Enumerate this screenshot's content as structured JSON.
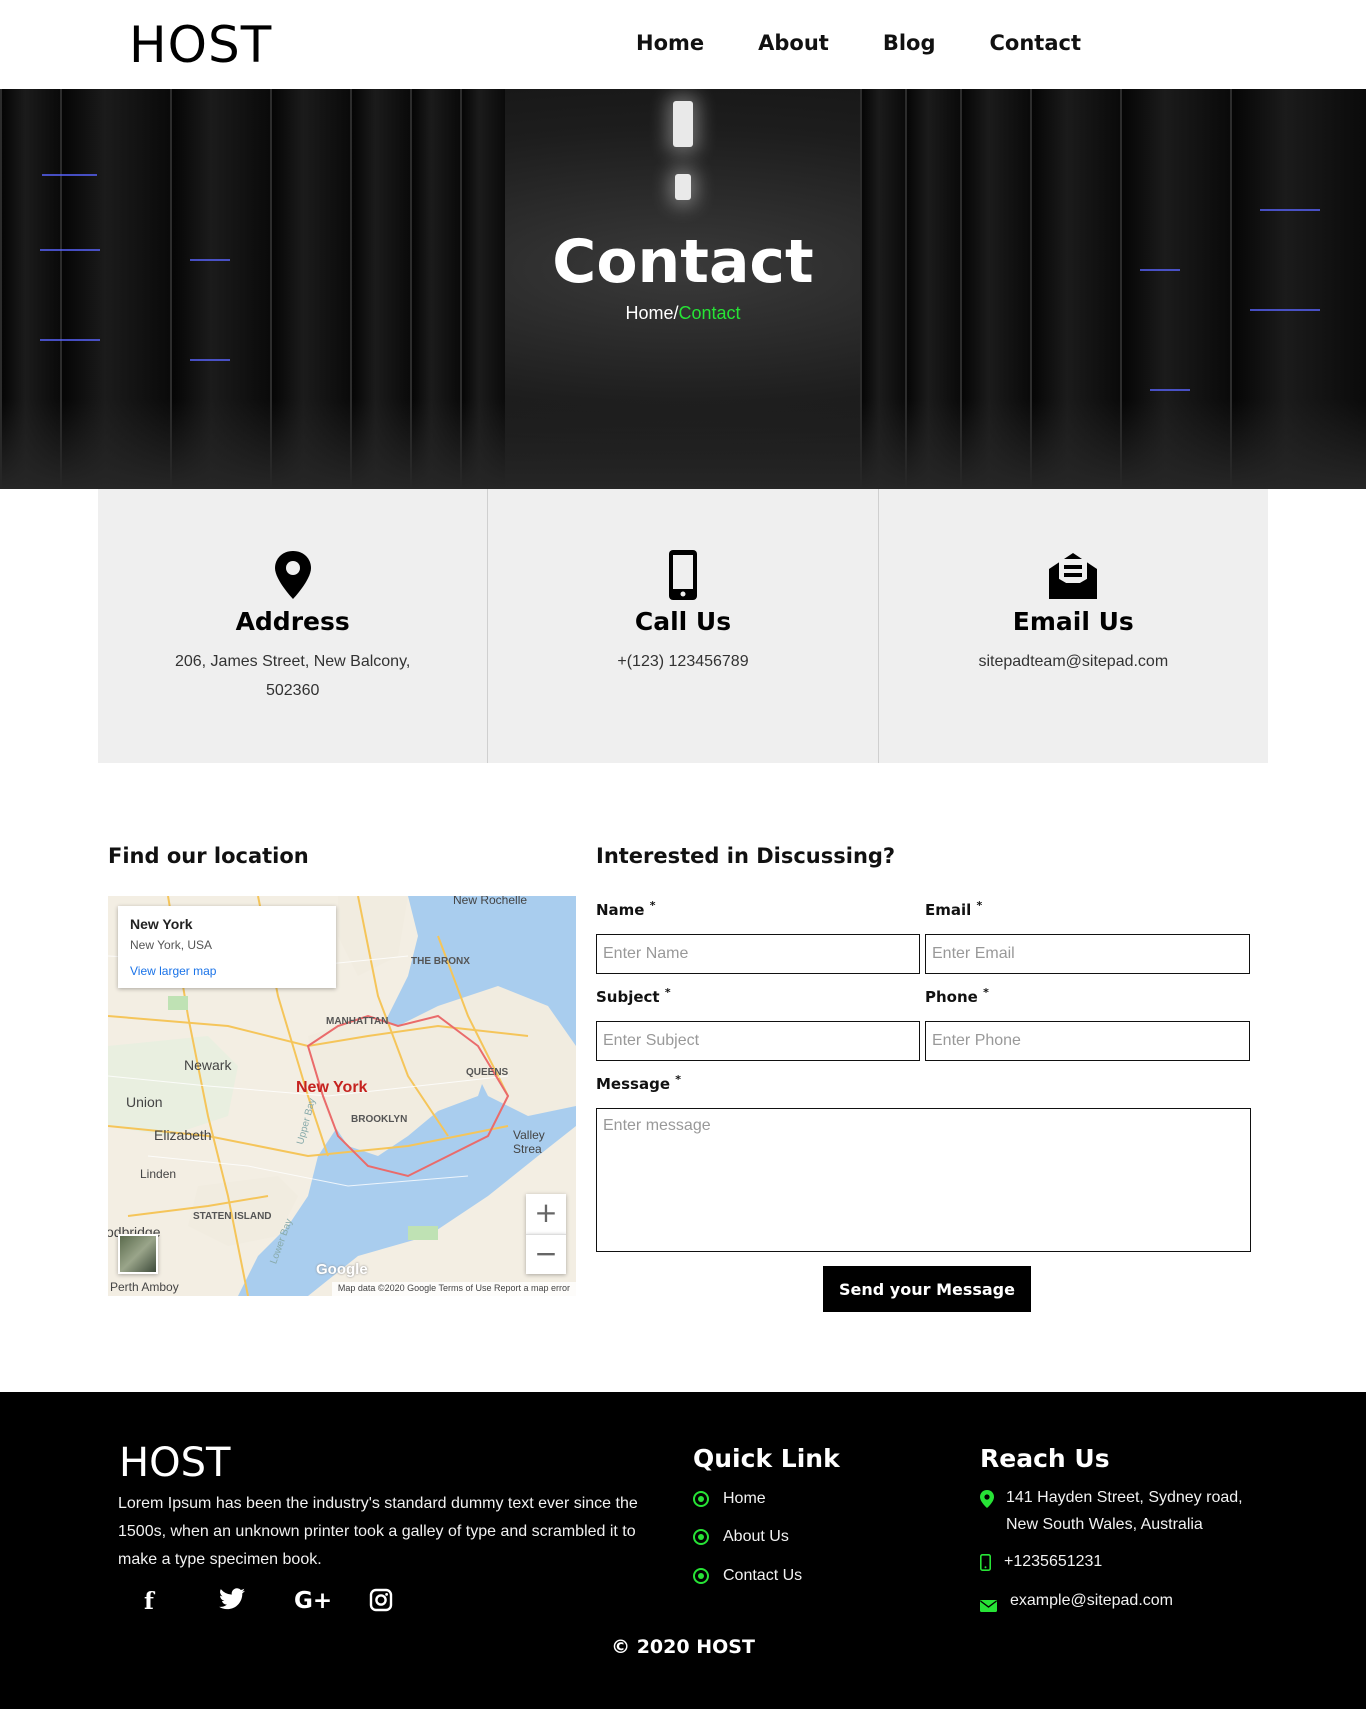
{
  "header": {
    "logo": "HOST",
    "nav": [
      {
        "label": "Home"
      },
      {
        "label": "About"
      },
      {
        "label": "Blog"
      },
      {
        "label": "Contact"
      }
    ]
  },
  "hero": {
    "title": "Contact",
    "breadcrumb_home": "Home",
    "breadcrumb_sep": "/",
    "breadcrumb_current": "Contact"
  },
  "info": {
    "address": {
      "title": "Address",
      "text": "206, James Street, New Balcony, 502360",
      "icon": "map-pin-icon"
    },
    "call": {
      "title": "Call Us",
      "text": "+(123) 123456789",
      "icon": "mobile-phone-icon"
    },
    "email": {
      "title": "Email Us",
      "text": "sitepadteam@sitepad.com",
      "icon": "envelope-open-icon"
    }
  },
  "location": {
    "title": "Find our location",
    "map": {
      "place": "New York",
      "place_sub": "New York, USA",
      "larger_map": "View larger map",
      "zoom_in": "+",
      "zoom_out": "−",
      "attribution": "Map data ©2020 Google   Terms of Use   Report a map error",
      "brand": "Google",
      "labels": [
        "New York",
        "Newark",
        "Union",
        "Elizabeth",
        "Linden",
        "MANHATTAN",
        "BROOKLYN",
        "QUEENS",
        "THE BRONX",
        "STATEN ISLAND",
        "Valley Strea",
        "Perth Amboy",
        "New Rochelle",
        "odbridge",
        "Upper Bay",
        "Lower Bay"
      ]
    }
  },
  "form": {
    "title": "Interested in Discussing?",
    "name_label": "Name",
    "name_placeholder": "Enter Name",
    "email_label": "Email",
    "email_placeholder": "Enter Email",
    "subject_label": "Subject",
    "subject_placeholder": "Enter Subject",
    "phone_label": "Phone",
    "phone_placeholder": "Enter Phone",
    "message_label": "Message",
    "message_placeholder": "Enter message",
    "required_mark": "*",
    "submit": "Send your Message"
  },
  "footer": {
    "logo": "HOST",
    "about": "Lorem Ipsum has been the industry's standard dummy text ever since the 1500s, when an unknown printer took a galley of type and scrambled it to make a type specimen book.",
    "social": [
      {
        "label": "f",
        "icon": "facebook-icon"
      },
      {
        "label": "🐦",
        "icon": "twitter-icon"
      },
      {
        "label": "G+",
        "icon": "google-plus-icon"
      },
      {
        "label": "◎",
        "icon": "instagram-icon"
      }
    ],
    "quick_link_title": "Quick Link",
    "quick_links": [
      {
        "label": "Home"
      },
      {
        "label": "About Us"
      },
      {
        "label": "Contact Us"
      }
    ],
    "reach_title": "Reach Us",
    "reach_address": "141 Hayden Street, Sydney road, New South Wales, Australia",
    "reach_phone": "+1235651231",
    "reach_email": "example@sitepad.com",
    "copyright": "© 2020 HOST"
  },
  "colors": {
    "accent": "#27e336",
    "footer_bg": "#000000",
    "info_bg": "#efefef"
  }
}
